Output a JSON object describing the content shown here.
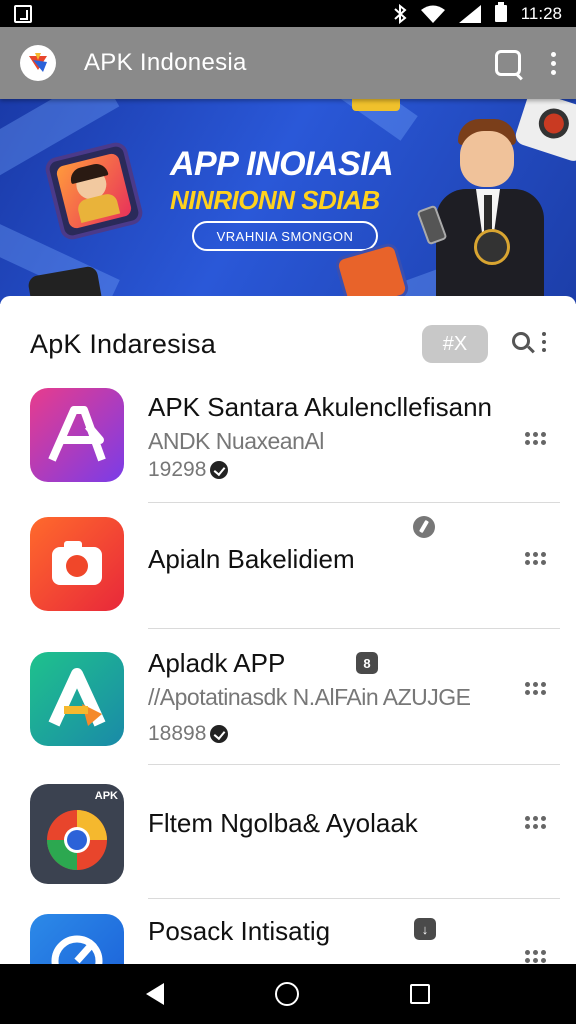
{
  "status_bar": {
    "time": "11:28"
  },
  "app_bar": {
    "title": "APK Indonesia"
  },
  "banner": {
    "title": "APP INOIASIA",
    "subtitle": "NINRIONN SDIAB",
    "pill_label": "VRAHNIA SMONGON"
  },
  "section": {
    "title": "ApK Indaresisa",
    "chip_label": "#X"
  },
  "apps": [
    {
      "name": "APK   Santara Akulencllefisann",
      "developer": "ANDK NuaxeanAl",
      "count": "19298"
    },
    {
      "name": "Apialn Bakelidiem"
    },
    {
      "name": "Apladk APP",
      "developer": "//Apotatinasdk N.AlFAin AZUJGE",
      "count": "18898"
    },
    {
      "name": "Fltem Ngolba& Ayolaak",
      "icon_badge": "APK"
    },
    {
      "name": "Posack Intisatig"
    }
  ],
  "colors": {
    "app_bar": "#8a8a8a",
    "banner_blue": "#1f45c0",
    "banner_yellow": "#ffd21e",
    "chip_gray": "#c8c8c8"
  }
}
